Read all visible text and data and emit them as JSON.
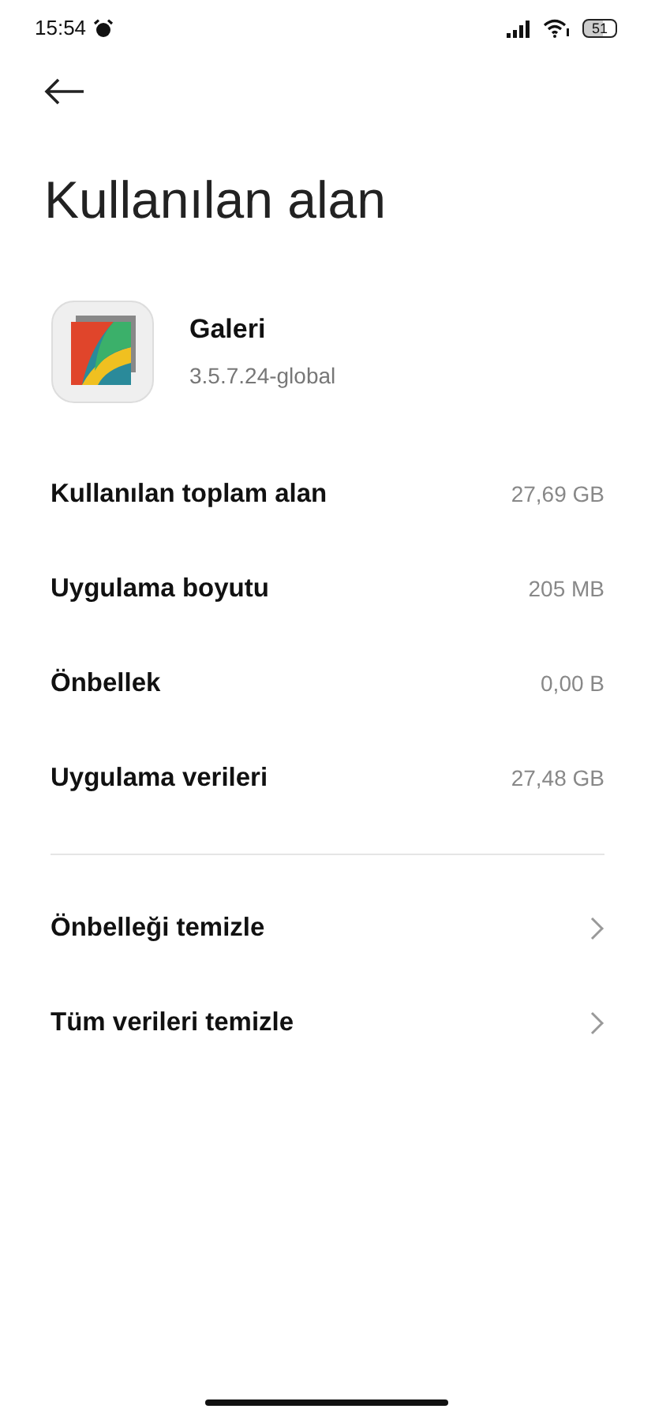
{
  "status_bar": {
    "time": "15:54",
    "battery": "51"
  },
  "title": "Kullanılan alan",
  "app": {
    "name": "Galeri",
    "version": "3.5.7.24-global"
  },
  "storage_rows": [
    {
      "label": "Kullanılan toplam alan",
      "value": "27,69 GB"
    },
    {
      "label": "Uygulama boyutu",
      "value": "205 MB"
    },
    {
      "label": "Önbellek",
      "value": "0,00 B"
    },
    {
      "label": "Uygulama verileri",
      "value": "27,48 GB"
    }
  ],
  "actions": [
    {
      "label": "Önbelleği temizle"
    },
    {
      "label": "Tüm verileri temizle"
    }
  ]
}
